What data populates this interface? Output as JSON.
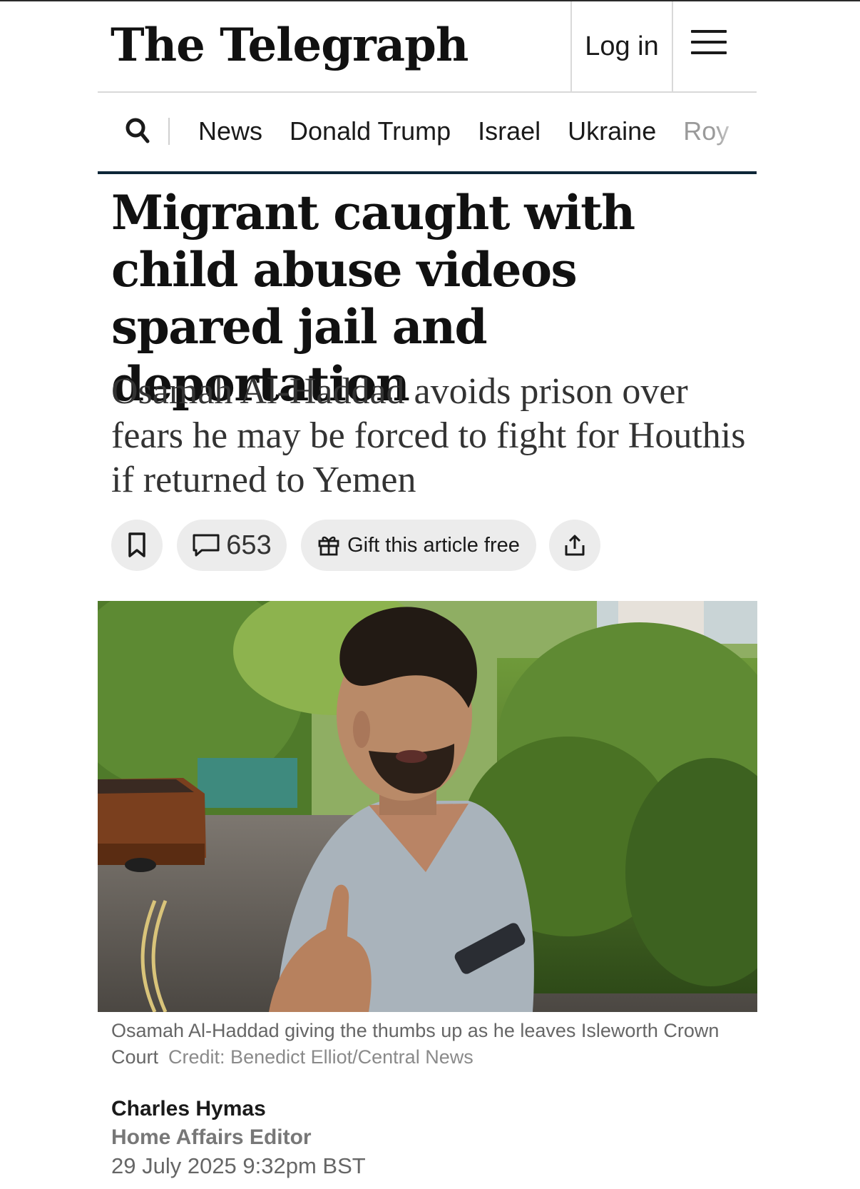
{
  "header": {
    "logo": "The Telegraph",
    "login_label": "Log in",
    "menu_icon": "hamburger-menu-icon"
  },
  "nav": {
    "search_icon": "search-icon",
    "items": [
      "News",
      "Donald Trump",
      "Israel",
      "Ukraine",
      "Roy"
    ]
  },
  "article": {
    "headline": "Migrant caught with child abuse videos spared jail and deportation",
    "standfirst": "Osamah Al-Haddad avoids prison over fears he may be forced to fight for Houthis if returned to Yemen",
    "actions": {
      "comment_count": "653",
      "gift_label": "Gift this article free"
    },
    "image": {
      "caption": "Osamah Al-Haddad giving the thumbs up as he leaves Isleworth Crown Court",
      "credit": "Credit: Benedict Elliot/Central News"
    },
    "byline": {
      "author": "Charles Hymas",
      "role": "Home Affairs Editor",
      "date": "29 July 2025 9:32pm BST"
    }
  },
  "colors": {
    "nav_rule": "#0d2637",
    "divider": "#d9d9d9",
    "pill_bg": "#ececec"
  }
}
